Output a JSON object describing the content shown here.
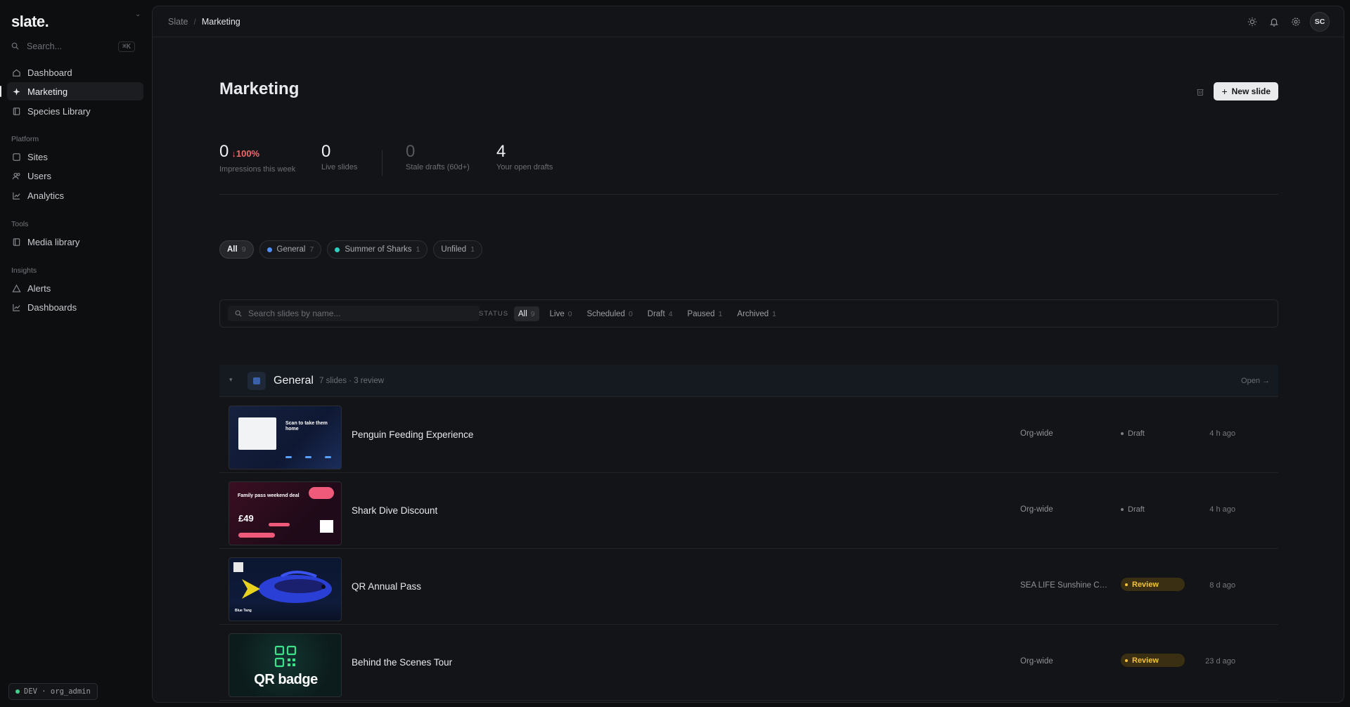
{
  "app": {
    "logo": "slate."
  },
  "sidebar": {
    "search_label": "Search...",
    "search_shortcut": "⌘K",
    "items_main": [
      {
        "label": "Dashboard",
        "icon": "home-icon"
      },
      {
        "label": "Marketing",
        "icon": "sparkle-icon",
        "active": true
      },
      {
        "label": "Species Library",
        "icon": "book-icon"
      }
    ],
    "section_platform": "Platform",
    "items_platform": [
      {
        "label": "Sites",
        "icon": "square-icon"
      },
      {
        "label": "Users",
        "icon": "users-icon"
      },
      {
        "label": "Analytics",
        "icon": "chart-icon"
      }
    ],
    "section_tools": "Tools",
    "items_tools": [
      {
        "label": "Media library",
        "icon": "library-icon"
      }
    ],
    "section_insights": "Insights",
    "items_insights": [
      {
        "label": "Alerts",
        "icon": "alert-icon"
      },
      {
        "label": "Dashboards",
        "icon": "chart-icon"
      }
    ],
    "env_badge": "DEV · org_admin"
  },
  "topbar": {
    "breadcrumb_root": "Slate",
    "breadcrumb_current": "Marketing",
    "avatar_initials": "SC"
  },
  "page": {
    "title": "Marketing",
    "new_button": "New slide"
  },
  "stats": [
    {
      "value": "0",
      "delta": "↓100%",
      "label": "Impressions this week"
    },
    {
      "value": "0",
      "label": "Live slides"
    },
    {
      "value": "0",
      "label": "Stale drafts (60d+)"
    },
    {
      "value": "4",
      "label": "Your open drafts"
    }
  ],
  "chips": [
    {
      "label": "All",
      "count": "9",
      "active": true
    },
    {
      "label": "General",
      "count": "7",
      "dot_color": "#4f8ff7"
    },
    {
      "label": "Summer of Sharks",
      "count": "1",
      "dot_color": "#2ecfc0"
    },
    {
      "label": "Unfiled",
      "count": "1"
    }
  ],
  "filter": {
    "search_placeholder": "Search slides by name...",
    "status_label": "STATUS",
    "tabs": [
      {
        "label": "All",
        "count": "9",
        "active": true
      },
      {
        "label": "Live",
        "count": "0"
      },
      {
        "label": "Scheduled",
        "count": "0"
      },
      {
        "label": "Draft",
        "count": "4"
      },
      {
        "label": "Paused",
        "count": "1"
      },
      {
        "label": "Archived",
        "count": "1"
      }
    ]
  },
  "group": {
    "name": "General",
    "meta": "7 slides · 3 review",
    "open_label": "Open →"
  },
  "rows": [
    {
      "name": "Penguin Feeding Experience",
      "scope": "Org-wide",
      "status": "Draft",
      "time": "4 h ago",
      "thumb": {
        "headline": "Scan to take them home"
      }
    },
    {
      "name": "Shark Dive Discount",
      "scope": "Org-wide",
      "status": "Draft",
      "time": "4 h ago",
      "thumb": {
        "headline": "Family pass weekend deal",
        "price": "£49"
      }
    },
    {
      "name": "QR Annual Pass",
      "scope": "SEA LIFE Sunshine Coast",
      "status": "Review",
      "time": "8 d ago",
      "thumb": {
        "caption": "Blue Tang"
      }
    },
    {
      "name": "Behind the Scenes Tour",
      "scope": "Org-wide",
      "status": "Review",
      "time": "23 d ago",
      "thumb": {
        "headline": "QR badge"
      }
    }
  ],
  "colors": {
    "accent_review": "#f3c13a",
    "delta_negative": "#f06a6a",
    "env_dot": "#3ecf8e"
  }
}
